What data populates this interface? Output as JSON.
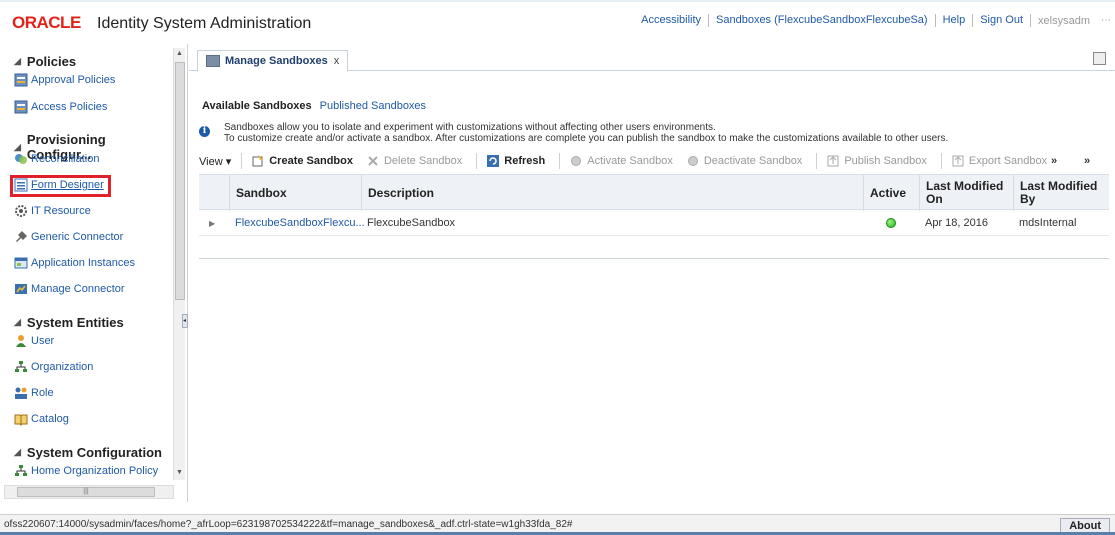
{
  "header": {
    "logo": "ORACLE",
    "title": "Identity System Administration",
    "links": [
      "Accessibility",
      "Sandboxes (FlexcubeSandboxFlexcubeSa)",
      "Help",
      "Sign Out"
    ],
    "user": "xelsysadm"
  },
  "nav": {
    "sections": {
      "policies": "Policies",
      "provisioning": "Provisioning Configur...",
      "entities": "System Entities",
      "configuration": "System Configuration"
    },
    "items": {
      "approval": "Approval Policies",
      "access": "Access Policies",
      "reconciliation": "Reconciliation",
      "form_designer": "Form Designer",
      "it_resource": "IT Resource",
      "generic_connector": "Generic Connector",
      "application_instances": "Application Instances",
      "manage_connector": "Manage Connector",
      "user": "User",
      "organization": "Organization",
      "role": "Role",
      "catalog": "Catalog",
      "home_org_policy": "Home Organization Policy"
    }
  },
  "main": {
    "tab_label": "Manage Sandboxes",
    "subtabs": [
      "Available Sandboxes",
      "Published Sandboxes"
    ],
    "info_line1": "Sandboxes allow you to isolate and experiment with customizations without affecting other users environments.",
    "info_line2": "To customize create and/or activate a sandbox. After customizations are complete you can publish the sandbox to make the customizations available to other users.",
    "toolbar": {
      "view": "View ▾",
      "create": "Create Sandbox",
      "delete": "Delete Sandbox",
      "refresh": "Refresh",
      "activate": "Activate Sandbox",
      "deactivate": "Deactivate Sandbox",
      "publish": "Publish Sandbox",
      "export": "Export Sandbox",
      "more1": "»",
      "more2": "»"
    },
    "columns": [
      "Sandbox",
      "Description",
      "Active",
      "Last Modified On",
      "Last Modified By"
    ],
    "rows": [
      {
        "sandbox": "FlexcubeSandboxFlexcu...",
        "description": "FlexcubeSandbox",
        "active": true,
        "modified_on": "Apr 18, 2016",
        "modified_by": "mdsInternal"
      }
    ]
  },
  "status": {
    "url": "ofss220607:14000/sysadmin/faces/home?_afrLoop=623198702534222&tf=manage_sandboxes&_adf.ctrl-state=w1gh33fda_82#",
    "about": "About"
  },
  "colors": {
    "oracle_red": "#e2231a",
    "link_blue": "#1f5aa6",
    "highlight_red": "#e0202a",
    "active_green": "#1fb61f"
  }
}
